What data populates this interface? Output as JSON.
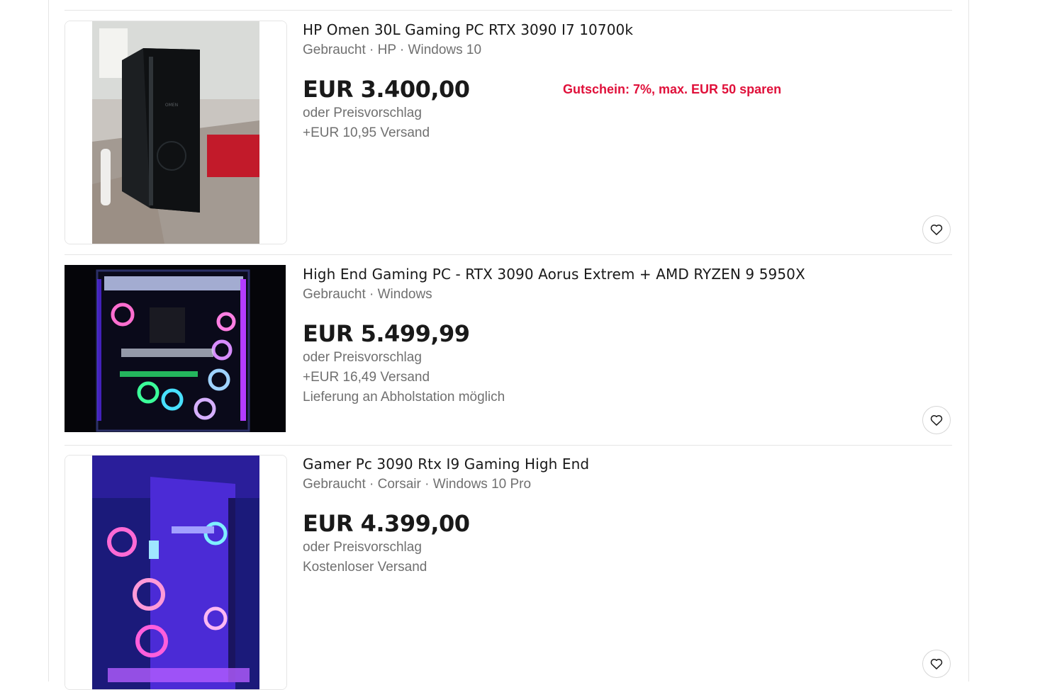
{
  "listings": [
    {
      "title": "HP Omen 30L Gaming PC RTX 3090 I7 10700k",
      "subtitle": "Gebraucht · HP · Windows 10",
      "price": "EUR 3.400,00",
      "offer": "oder Preisvorschlag",
      "shipping": "+EUR 10,95 Versand",
      "coupon": "Gutschein: 7%, max. EUR 50 sparen",
      "image_icon": "gaming-pc-black-tower-photo"
    },
    {
      "title": "High End Gaming PC - RTX 3090 Aorus Extrem + AMD RYZEN 9 5950X",
      "subtitle": "Gebraucht · Windows",
      "price": "EUR 5.499,99",
      "offer": "oder Preisvorschlag",
      "shipping": "+EUR 16,49 Versand",
      "pickup": "Lieferung an Abholstation möglich",
      "image_icon": "rgb-gaming-pc-photo"
    },
    {
      "title": "Gamer Pc 3090 Rtx I9 Gaming High End",
      "subtitle": "Gebraucht · Corsair · Windows 10 Pro",
      "price": "EUR 4.399,00",
      "offer": "oder Preisvorschlag",
      "shipping": "Kostenloser Versand",
      "image_icon": "purple-rgb-gaming-pc-photo"
    }
  ],
  "colors": {
    "coupon": "#e0103a",
    "price": "#191919",
    "secondary_text": "#707070",
    "divider": "#e5e5e5"
  },
  "watchlist_icon": "heart-icon"
}
